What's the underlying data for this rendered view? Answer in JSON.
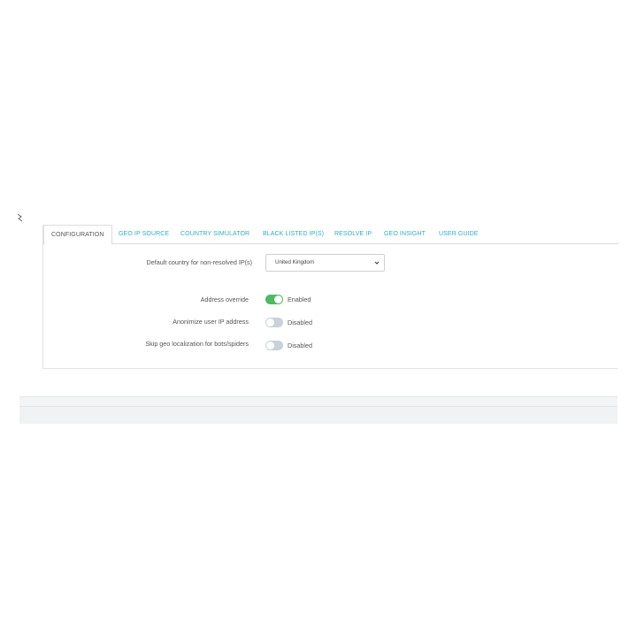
{
  "tabs": [
    {
      "label": "CONFIGURATION",
      "active": true
    },
    {
      "label": "GEO IP SOURCE",
      "active": false
    },
    {
      "label": "COUNTRY SIMULATOR",
      "active": false
    },
    {
      "label": "BLACK LISTED IP(S)",
      "active": false
    },
    {
      "label": "RESOLVE IP",
      "active": false
    },
    {
      "label": "GEO INSIGHT",
      "active": false
    },
    {
      "label": "USER GUIDE",
      "active": false
    }
  ],
  "default_country": {
    "label": "Default country for non-resolved IP(s)",
    "value": "United Kingdom"
  },
  "settings": [
    {
      "label": "Address override",
      "state": "on",
      "status": "Enabled"
    },
    {
      "label": "Anonimize user IP address",
      "state": "off",
      "status": "Disabled"
    },
    {
      "label": "Skip geo localization for bots/spiders",
      "state": "off",
      "status": "Disabled"
    }
  ],
  "colors": {
    "accent": "#2eacce",
    "toggle_on": "#4cbb5f",
    "toggle_off": "#c8d2d8"
  },
  "icons": {
    "corner": "arrow-icon",
    "select": "chevron-down-icon"
  }
}
